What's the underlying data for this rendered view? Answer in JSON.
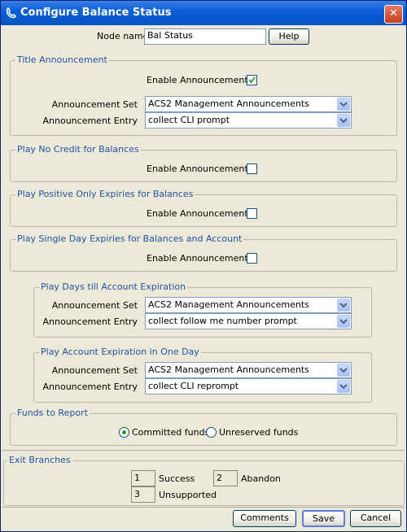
{
  "window": {
    "title": "Configure Balance Status",
    "close": "✕"
  },
  "node": {
    "label": "Node name",
    "value": "Bal Status",
    "help": "Help"
  },
  "title_announcement": {
    "heading": "Title Announcement",
    "enable_label": "Enable Announcement",
    "enabled": true,
    "set_label": "Announcement Set",
    "set_value": "ACS2 Management Announcements",
    "entry_label": "Announcement Entry",
    "entry_value": "collect CLI prompt"
  },
  "no_credit": {
    "heading": "Play No Credit for Balances",
    "enable_label": "Enable Announcement",
    "enabled": false
  },
  "positive_expiries": {
    "heading": "Play Positive Only Expiries for Balances",
    "enable_label": "Enable Announcement",
    "enabled": false
  },
  "single_day": {
    "heading": "Play Single Day Expiries for Balances and Account",
    "enable_label": "Enable Announcement",
    "enabled": false
  },
  "days_till": {
    "heading": "Play Days till Account Expiration",
    "set_label": "Announcement Set",
    "set_value": "ACS2 Management Announcements",
    "entry_label": "Announcement Entry",
    "entry_value": "collect follow me number prompt"
  },
  "one_day": {
    "heading": "Play Account Expiration in One Day",
    "set_label": "Announcement Set",
    "set_value": "ACS2 Management Announcements",
    "entry_label": "Announcement Entry",
    "entry_value": "collect CLI reprompt"
  },
  "funds": {
    "heading": "Funds to Report",
    "option_committed": "Committed funds",
    "option_unreserved": "Unreserved funds",
    "selected": "Committed funds"
  },
  "exit_branches": {
    "heading": "Exit Branches",
    "branches": [
      {
        "num": "1",
        "label": "Success"
      },
      {
        "num": "2",
        "label": "Abandon"
      },
      {
        "num": "3",
        "label": "Unsupported"
      }
    ]
  },
  "footer": {
    "comments": "Comments",
    "save": "Save",
    "cancel": "Cancel"
  },
  "colors": {
    "titlebar": "#0a5fd8",
    "group_title": "#2152a6",
    "background": "#ece9d8"
  }
}
